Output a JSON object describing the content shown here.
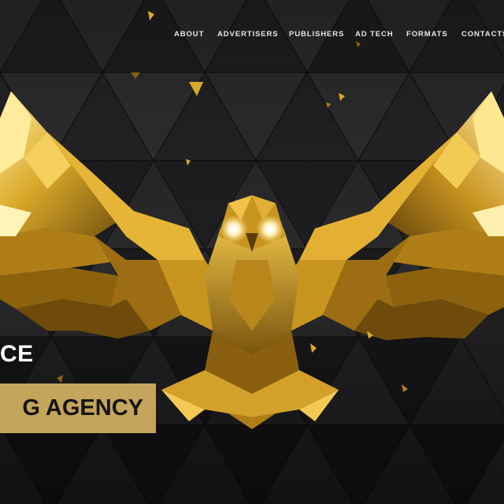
{
  "nav": {
    "items": [
      {
        "label": "ABOUT"
      },
      {
        "label": "ADVERTISERS"
      },
      {
        "label": "PUBLISHERS"
      },
      {
        "label": "AD TECH"
      },
      {
        "label": "FORMATS"
      },
      {
        "label": "CONTACTS"
      }
    ]
  },
  "hero": {
    "line1": "CE",
    "line2": "G AGENCY"
  },
  "colors": {
    "background": "#1c1c1e",
    "accent_gold": "#c5a45b",
    "nav_text": "#e8e8e8"
  },
  "icons": [
    "golden-owl-illustration"
  ]
}
